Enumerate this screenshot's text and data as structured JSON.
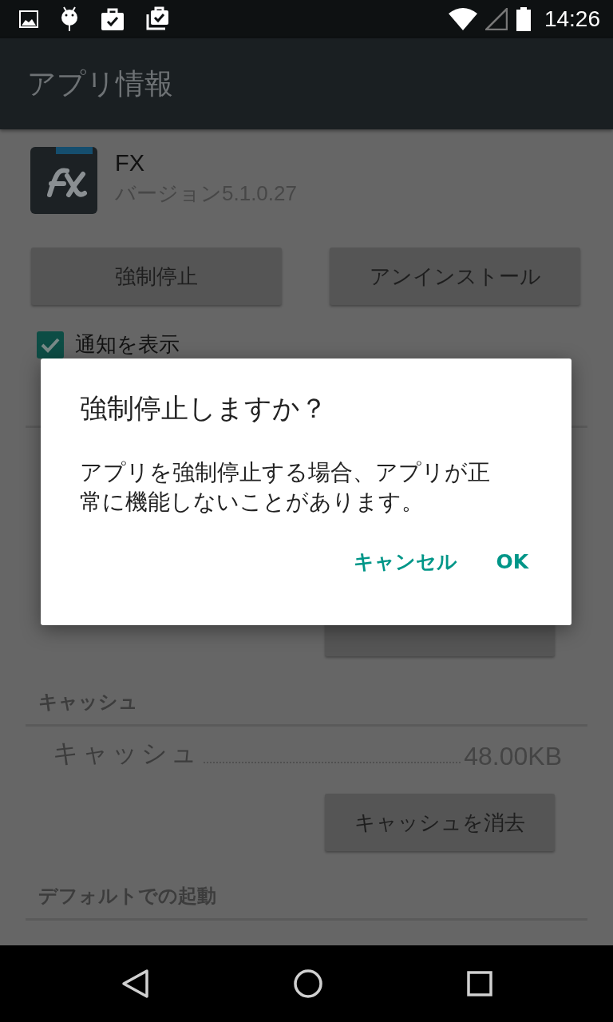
{
  "status_bar": {
    "time": "14:26"
  },
  "action_bar": {
    "title": "アプリ情報"
  },
  "app": {
    "name": "FX",
    "version": "バージョン5.1.0.27"
  },
  "buttons": [
    "強制停止",
    "アンインストール"
  ],
  "notification_checkbox": {
    "label": "通知を表示",
    "checked": true
  },
  "cache": {
    "header": "キャッシュ",
    "label": "キャッシュ",
    "value": "48.00KB",
    "clear_button": "キャッシュを消去"
  },
  "launch_default": {
    "header": "デフォルトでの起動"
  },
  "dialog": {
    "title": "強制停止しますか？",
    "message": "アプリを強制停止する場合、アプリが正常に機能しないことがあります。",
    "buttons": [
      "キャンセル",
      "OK"
    ]
  }
}
